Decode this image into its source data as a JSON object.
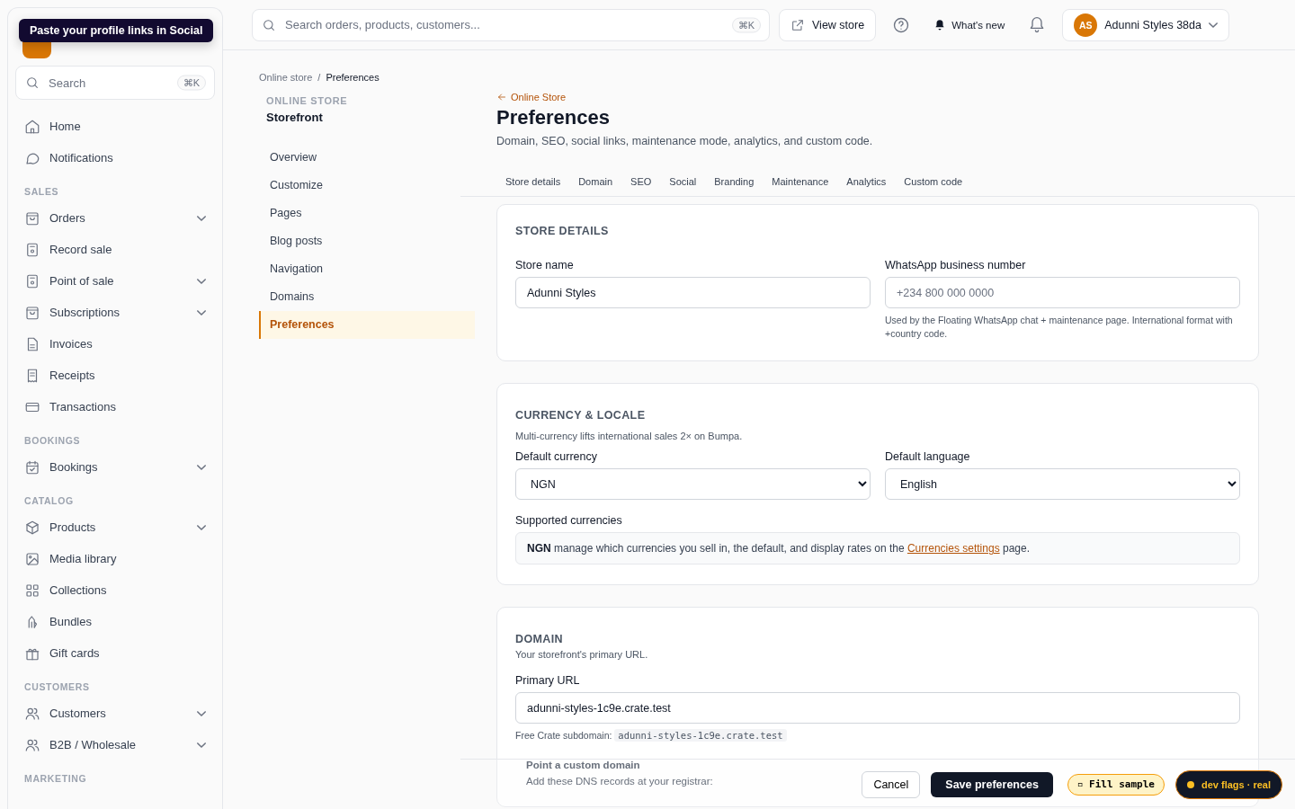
{
  "tooltip": "Paste your profile links in Social",
  "sidebar": {
    "search": {
      "placeholder": "Search",
      "shortcut": "⌘K"
    },
    "sections": [
      {
        "items": [
          {
            "label": "Home",
            "kind": "link"
          },
          {
            "label": "Notifications",
            "kind": "link"
          }
        ]
      },
      {
        "title": "SALES",
        "items": [
          {
            "label": "Orders",
            "kind": "group"
          },
          {
            "label": "Record sale",
            "kind": "link"
          },
          {
            "label": "Point of sale",
            "kind": "group"
          },
          {
            "label": "Subscriptions",
            "kind": "group"
          },
          {
            "label": "Invoices",
            "kind": "link"
          },
          {
            "label": "Receipts",
            "kind": "link"
          },
          {
            "label": "Transactions",
            "kind": "link"
          }
        ]
      },
      {
        "title": "BOOKINGS",
        "items": [
          {
            "label": "Bookings",
            "kind": "group"
          }
        ]
      },
      {
        "title": "CATALOG",
        "items": [
          {
            "label": "Products",
            "kind": "group"
          },
          {
            "label": "Media library",
            "kind": "link"
          },
          {
            "label": "Collections",
            "kind": "link"
          },
          {
            "label": "Bundles",
            "kind": "link"
          },
          {
            "label": "Gift cards",
            "kind": "link"
          }
        ]
      },
      {
        "title": "CUSTOMERS",
        "items": [
          {
            "label": "Customers",
            "kind": "group"
          },
          {
            "label": "B2B / Wholesale",
            "kind": "group"
          }
        ]
      },
      {
        "title": "MARKETING"
      }
    ]
  },
  "topbar": {
    "search": {
      "placeholder": "Search orders, products, customers...",
      "shortcut": "⌘K"
    },
    "view_store": "View store",
    "whats_new": "What's new",
    "account": {
      "initials": "AS",
      "name": "Adunni Styles 38da"
    }
  },
  "breadcrumb": {
    "separator": "/",
    "items": [
      "Online store",
      "Preferences"
    ]
  },
  "subnav": {
    "eyebrow": "ONLINE STORE",
    "title": "Storefront",
    "items": [
      {
        "label": "Overview",
        "selected": false
      },
      {
        "label": "Customize",
        "selected": false
      },
      {
        "label": "Pages",
        "selected": false
      },
      {
        "label": "Blog posts",
        "selected": false
      },
      {
        "label": "Navigation",
        "selected": false
      },
      {
        "label": "Domains",
        "selected": false
      },
      {
        "label": "Preferences",
        "selected": true
      }
    ]
  },
  "header": {
    "back": "Online Store",
    "title": "Preferences",
    "subtitle": "Domain, SEO, social links, maintenance mode, analytics, and custom code."
  },
  "tabs": [
    {
      "label": "Store details",
      "selected": false
    },
    {
      "label": "Domain",
      "selected": false
    },
    {
      "label": "SEO",
      "selected": false
    },
    {
      "label": "Social",
      "selected": false
    },
    {
      "label": "Branding",
      "selected": false
    },
    {
      "label": "Maintenance",
      "selected": false
    },
    {
      "label": "Analytics",
      "selected": false
    },
    {
      "label": "Custom code",
      "selected": false
    }
  ],
  "store_details": {
    "title": "STORE DETAILS",
    "store_name": {
      "label": "Store name",
      "value": "Adunni Styles"
    },
    "whatsapp": {
      "label": "WhatsApp business number",
      "placeholder": "+234 800 000 0000",
      "help": "Used by the Floating WhatsApp chat + maintenance page. International format with +country code."
    }
  },
  "currency": {
    "title": "CURRENCY & LOCALE",
    "note": "Multi-currency lifts international sales 2× on Bumpa.",
    "default_currency": {
      "label": "Default currency",
      "value": "NGN"
    },
    "default_language": {
      "label": "Default language",
      "value": "English"
    },
    "supported": {
      "label": "Supported currencies",
      "code": "NGN",
      "text": "manage which currencies you sell in, the default, and display rates on the",
      "link": "Currencies settings",
      "tail": "page."
    }
  },
  "domain": {
    "title": "DOMAIN",
    "note": "Your storefront's primary URL.",
    "primary": {
      "label": "Primary URL",
      "value": "adunni-styles-1c9e.crate.test"
    },
    "help": "Free Crate subdomain:",
    "subdomain": "adunni-styles-1c9e.crate.test",
    "custom_title": "Point a custom domain",
    "custom_note": "Add these DNS records at your registrar:"
  },
  "footer": {
    "cancel": "Cancel",
    "save": "Save preferences",
    "fill_sample": "▫ Fill sample",
    "dev_flags": "dev flags · real"
  }
}
